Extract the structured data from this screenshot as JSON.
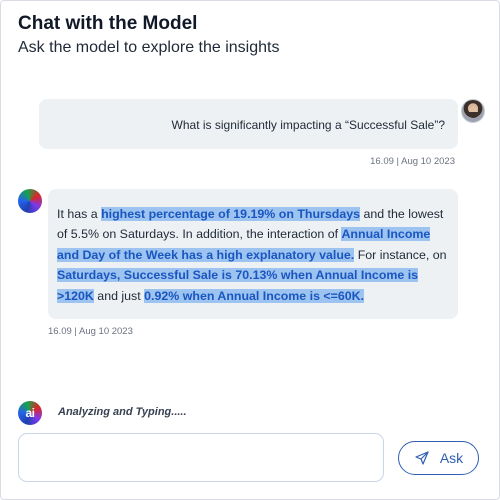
{
  "header": {
    "title": "Chat with the Model",
    "subtitle": "Ask the model to explore the insights"
  },
  "messages": [
    {
      "role": "user",
      "text": "What is significantly impacting a “Successful Sale”?",
      "time": "16.09",
      "date": "Aug 10 2023",
      "meta": "16.09  |  Aug 10 2023"
    },
    {
      "role": "assistant",
      "segments": [
        {
          "text": "It has a ",
          "highlight": false
        },
        {
          "text": "highest percentage of 19.19% on Thursdays",
          "highlight": true
        },
        {
          "text": " and the lowest of 5.5% on Saturdays. In addition, the interaction of ",
          "highlight": false
        },
        {
          "text": "Annual Income and Day of the Week has a high explanatory value.",
          "highlight": true
        },
        {
          "text": " For instance, on ",
          "highlight": false
        },
        {
          "text": "Saturdays, Successful Sale is 70.13% when Annual Income is >120K",
          "highlight": true
        },
        {
          "text": " and just ",
          "highlight": false
        },
        {
          "text": "0.92% when Annual Income is <=60K.",
          "highlight": true
        }
      ],
      "time": "16.09",
      "date": "Aug 10 2023",
      "meta": "16.09  |  Aug 10 2023"
    }
  ],
  "typing": {
    "avatar_label": "ai",
    "text": "Analyzing and Typing....."
  },
  "composer": {
    "value": "",
    "placeholder": "",
    "button_label": "Ask"
  },
  "colors": {
    "accent": "#2f5fb3",
    "highlight_bg": "#9dc3f0",
    "highlight_text": "#1a56c0",
    "bubble_bg": "#eef1f4"
  },
  "icons": {
    "send": "send-icon",
    "user_avatar": "user-avatar",
    "assistant_avatar": "assistant-avatar-icon"
  }
}
